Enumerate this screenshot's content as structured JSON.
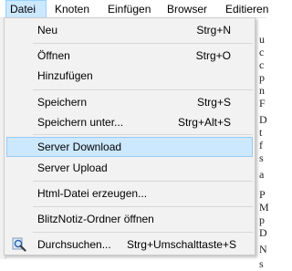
{
  "menubar": {
    "items": [
      {
        "label": "Datei"
      },
      {
        "label": "Knoten"
      },
      {
        "label": "Einfügen"
      },
      {
        "label": "Browser"
      },
      {
        "label": "Editieren"
      }
    ]
  },
  "menu": {
    "items": [
      {
        "label": "Neu",
        "shortcut": "Strg+N"
      },
      {
        "label": "Öffnen",
        "shortcut": "Strg+O"
      },
      {
        "label": "Hinzufügen",
        "shortcut": ""
      },
      {
        "label": "Speichern",
        "shortcut": "Strg+S"
      },
      {
        "label": "Speichern unter...",
        "shortcut": "Strg+Alt+S"
      },
      {
        "label": "Server Download",
        "shortcut": ""
      },
      {
        "label": "Server Upload",
        "shortcut": ""
      },
      {
        "label": "Html-Datei erzeugen...",
        "shortcut": ""
      },
      {
        "label": "BlitzNotiz-Ordner öffnen",
        "shortcut": ""
      },
      {
        "label": "Durchsuchen...",
        "shortcut": "Strg+Umschalttaste+S",
        "icon": "search-icon"
      }
    ],
    "highlighted": "Server Download"
  },
  "background": {
    "fragments": [
      "u",
      "c",
      "c",
      "p",
      "n",
      "F",
      "D",
      "t",
      "f",
      "s",
      "a",
      "P",
      "M",
      "p",
      "D",
      "N",
      "s"
    ]
  },
  "colors": {
    "highlight": "#cce8ff",
    "highlight_border": "#99c9ef",
    "menu_bg": "#f2f2f2"
  }
}
